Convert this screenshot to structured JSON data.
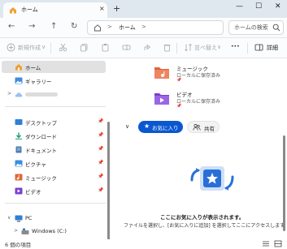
{
  "tab": {
    "title": "ホーム",
    "close": "×",
    "new": "+"
  },
  "window_controls": {
    "minimize": "—",
    "maximize": "☐",
    "close": "✕"
  },
  "nav": {
    "back": "←",
    "forward": "→",
    "up": "↑",
    "refresh": "↻"
  },
  "address": {
    "chevron1": ">",
    "location": "ホーム",
    "chevron2": ">"
  },
  "search": {
    "placeholder": "ホームの検索"
  },
  "commandbar": {
    "new_label": "新規作成",
    "new_chevron": "∨",
    "sort_label": "並べ替え",
    "sort_chevron": "∨",
    "more": "•••",
    "details_label": "詳細"
  },
  "sidebar": {
    "home": "ホーム",
    "gallery": "ギャラリー",
    "onedrive_chevron": ">",
    "quick": [
      {
        "label": "デスクトップ",
        "color": "#2f7fd6"
      },
      {
        "label": "ダウンロード",
        "color": "#1f9a6e"
      },
      {
        "label": "ドキュメント",
        "color": "#4a7fb5"
      },
      {
        "label": "ピクチャ",
        "color": "#3b8ee0"
      },
      {
        "label": "ミュージック",
        "color": "#e0653a"
      },
      {
        "label": "ビデオ",
        "color": "#7a3fd0"
      }
    ],
    "pin": "📌",
    "pc_chevron": "∨",
    "pc": "PC",
    "drive_chevron": ">",
    "drive": "Windows (C:)"
  },
  "main": {
    "files": [
      {
        "name": "ミュージック",
        "sub": "ローカルに保存済み",
        "color": "#e0653a"
      },
      {
        "name": "ビデオ",
        "sub": "ローカルに保存済み",
        "color": "#7a3fd0"
      }
    ],
    "collapse": "∨",
    "favorites_label": "お気に入り",
    "favorites_icon": "★",
    "shared_label": "共有",
    "empty_title": "ここにお気に入りが表示されます。",
    "empty_desc": "ファイルを選択し、[お気に入りに追加] を選択してここにアクセスします"
  },
  "status": {
    "count": "6 個の項目"
  },
  "colors": {
    "accent": "#0b57d0",
    "tabbar": "#dfe7ef",
    "selected": "#e1e1e1"
  }
}
